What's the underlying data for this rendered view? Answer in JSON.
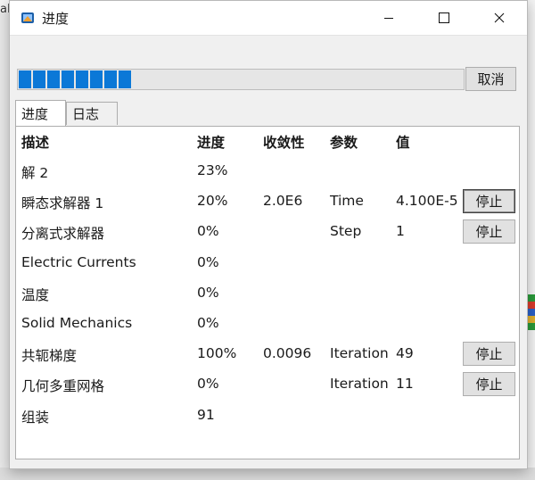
{
  "background": {
    "fragment": "al"
  },
  "window": {
    "title": "进度"
  },
  "progress": {
    "fraction": 0.25,
    "cancel_label": "取消"
  },
  "tabs": [
    "进度",
    "日志"
  ],
  "table": {
    "headers": [
      "描述",
      "进度",
      "收敛性",
      "参数",
      "值"
    ],
    "rows": [
      {
        "desc": "解 2",
        "progress": "23%",
        "conv": "",
        "param": "",
        "value": "",
        "stop": ""
      },
      {
        "desc": "瞬态求解器 1",
        "progress": "20%",
        "conv": "2.0E6",
        "param": "Time",
        "value": "4.100E-5",
        "stop": "停止"
      },
      {
        "desc": "分离式求解器",
        "progress": "0%",
        "conv": "",
        "param": "Step",
        "value": "1",
        "stop": "停止"
      },
      {
        "desc": "Electric Currents",
        "progress": "0%",
        "conv": "",
        "param": "",
        "value": "",
        "stop": ""
      },
      {
        "desc": "温度",
        "progress": "0%",
        "conv": "",
        "param": "",
        "value": "",
        "stop": ""
      },
      {
        "desc": "Solid Mechanics",
        "progress": "0%",
        "conv": "",
        "param": "",
        "value": "",
        "stop": ""
      },
      {
        "desc": "共轭梯度",
        "progress": "100%",
        "conv": "0.0096",
        "param": "Iteration",
        "value": "49",
        "stop": "停止"
      },
      {
        "desc": "几何多重网格",
        "progress": "0%",
        "conv": "",
        "param": "Iteration",
        "value": "11",
        "stop": "停止"
      },
      {
        "desc": "组装",
        "progress": "91",
        "conv": "",
        "param": "",
        "value": "",
        "stop": ""
      }
    ]
  },
  "colors": {
    "accent": "#0b78d7"
  }
}
